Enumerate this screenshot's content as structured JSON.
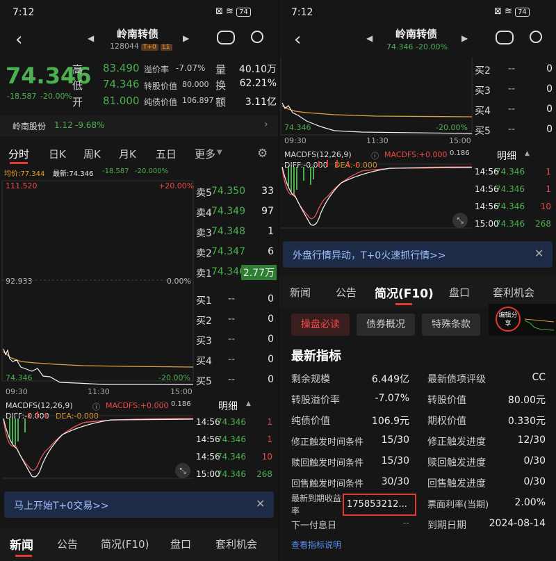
{
  "status": {
    "time": "7:12",
    "battery": "74"
  },
  "header": {
    "title": "岭南转债",
    "code": "128044",
    "tag1": "T+0",
    "tag2": "L1",
    "sub_price_right": "74.346 -20.00%"
  },
  "quote": {
    "price": "74.346",
    "change": "-18.587",
    "change_pct": "-20.00%",
    "high_label": "高",
    "high": "83.490",
    "low_label": "低",
    "low": "74.346",
    "open_label": "开",
    "open": "81.000",
    "premium_label": "溢价率",
    "premium": "-7.07%",
    "conv_price_label": "转股价值",
    "conv_price": "80.000",
    "pure_label": "纯债价值",
    "pure": "106.897",
    "vol_label": "量",
    "vol": "40.10万",
    "turn_label": "换",
    "turn": "62.21%",
    "amt_label": "额",
    "amt": "3.11亿"
  },
  "stock": {
    "name": "岭南股份",
    "price": "1.12",
    "pct": "-9.68%"
  },
  "chart_tabs": [
    "分时",
    "日K",
    "周K",
    "月K",
    "五日",
    "更多"
  ],
  "avg_line": {
    "avg_label": "均价:77.344",
    "last_label": "最新:74.346",
    "chg": "-18.587",
    "pct": "-20.000%"
  },
  "chart_labels": {
    "top": "111.520",
    "top_pct": "+20.00%",
    "mid": "92.933",
    "mid_pct": "0.00%",
    "bottom": "74.346",
    "bottom_pct": "-20.00%",
    "t0": "09:30",
    "t1": "11:30",
    "t2": "15:00"
  },
  "orderbook": {
    "sells": [
      {
        "label": "卖5",
        "price": "74.350",
        "vol": "33"
      },
      {
        "label": "卖4",
        "price": "74.349",
        "vol": "97"
      },
      {
        "label": "卖3",
        "price": "74.348",
        "vol": "1"
      },
      {
        "label": "卖2",
        "price": "74.347",
        "vol": "6"
      },
      {
        "label": "卖1",
        "price": "74.346",
        "vol": "2.77万"
      }
    ],
    "buys": [
      {
        "label": "买1",
        "price": "--",
        "vol": "0"
      },
      {
        "label": "买2",
        "price": "--",
        "vol": "0"
      },
      {
        "label": "买3",
        "price": "--",
        "vol": "0"
      },
      {
        "label": "买4",
        "price": "--",
        "vol": "0"
      },
      {
        "label": "买5",
        "price": "--",
        "vol": "0"
      }
    ]
  },
  "macd": {
    "title": "MACDFS(12,26,9)",
    "value_label": "MACDFS:+0.000",
    "diff": "DIFF:-0.000",
    "dea": "DEA:-0.000",
    "axis": "0.186"
  },
  "ticks": {
    "title": "明细",
    "rows": [
      {
        "time": "14:56",
        "price": "74.346",
        "vol": "1"
      },
      {
        "time": "14:56",
        "price": "74.346",
        "vol": "1"
      },
      {
        "time": "14:56",
        "price": "74.346",
        "vol": "10"
      },
      {
        "time": "15:00",
        "price": "74.346",
        "vol": "268"
      }
    ]
  },
  "banner_left": "马上开始T+0交易>>",
  "banner_right": "外盘行情异动，T+0火速抓行情>>",
  "bottom_tabs": [
    "新闻",
    "公告",
    "简况(F10)",
    "盘口",
    "套利机会"
  ],
  "f10": {
    "buttons": [
      "操盘必读",
      "债券概况",
      "特殊条款"
    ],
    "thumb_label": "编辑分享",
    "section_title": "最新指标",
    "left": [
      {
        "k": "剩余规模",
        "v": "6.449亿"
      },
      {
        "k": "转股溢价率",
        "v": "-7.07%"
      },
      {
        "k": "纯债价值",
        "v": "106.9元"
      },
      {
        "k": "修正触发时间条件",
        "v": "15/30"
      },
      {
        "k": "赎回触发时间条件",
        "v": "15/30"
      },
      {
        "k": "回售触发时间条件",
        "v": "30/30"
      },
      {
        "k": "最新到期收益",
        "k2": "率",
        "v": "175853212..."
      },
      {
        "k": "下一付息日",
        "v": "--"
      }
    ],
    "right": [
      {
        "k": "最新债项评级",
        "v": "CC"
      },
      {
        "k": "转股价值",
        "v": "80.00元"
      },
      {
        "k": "期权价值",
        "v": "0.330元"
      },
      {
        "k": "修正触发进度",
        "v": "12/30"
      },
      {
        "k": "赎回触发进度",
        "v": "0/30"
      },
      {
        "k": "回售触发进度",
        "v": "0/30"
      },
      {
        "k": "票面利率(当期)",
        "v": "2.00%"
      },
      {
        "k": "到期日期",
        "v": "2024-08-14"
      }
    ],
    "link": "查看指标说明"
  }
}
